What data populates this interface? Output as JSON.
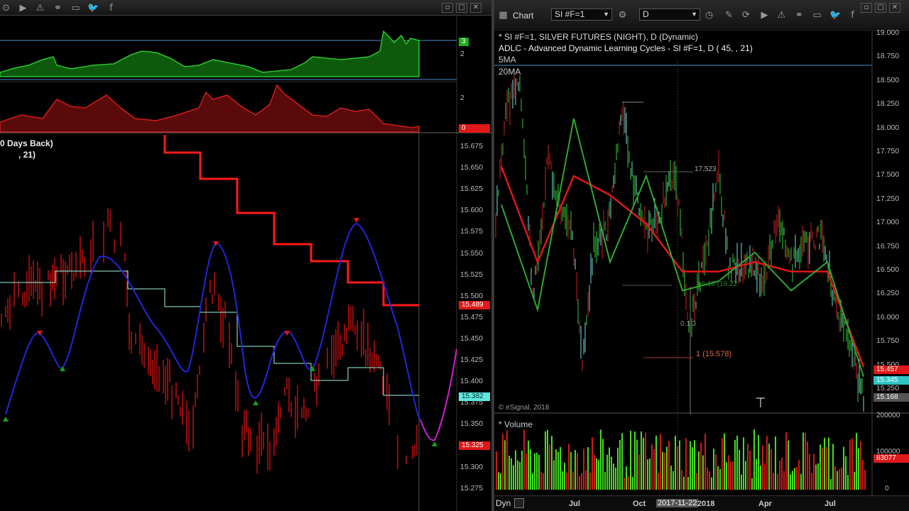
{
  "left": {
    "legend_line1": "0 Days Back)",
    "legend_line2": ", 21)",
    "osc1_tags": {
      "top": "3",
      "mid": "2"
    },
    "osc2_tags": {
      "mid": "2",
      "zero": "0"
    },
    "price_ticks": [
      "15.675",
      "15.650",
      "15.625",
      "15.600",
      "15.575",
      "15.550",
      "15.525",
      "15.500",
      "15.475",
      "15.450",
      "15.425",
      "15.400",
      "15.375",
      "15.350",
      "15.325",
      "15.300",
      "15.275"
    ],
    "price_tags": {
      "red1": "15.489",
      "cyan": "15.382",
      "red2": "15.325"
    },
    "colors": {
      "green": "#1fae1f",
      "red": "#c01010",
      "blue": "#2020d0",
      "cyan": "#9ff6e8",
      "magenta": "#d020d0"
    }
  },
  "right": {
    "window_title": "Chart",
    "symbol_field": "SI #F=1",
    "interval_field": "D",
    "header_line1": "* SI #F=1, SILVER FUTURES (NIGHT), D (Dynamic)",
    "header_line2": "ADLC - Advanced Dynamic Learning Cycles - SI #F=1, D (        45,         , 21)",
    "ma_labels": [
      "5MA",
      "20MA"
    ],
    "price_ticks": [
      "19.000",
      "18.750",
      "18.500",
      "18.250",
      "18.000",
      "17.750",
      "17.500",
      "17.250",
      "17.000",
      "16.750",
      "16.500",
      "16.250",
      "16.000",
      "15.750",
      "15.500",
      "15.250"
    ],
    "price_tags": {
      "red": "15.457",
      "cyan": "15.345",
      "gray": "15.168"
    },
    "annotations": {
      "high": "17.523",
      "mid": "16.18  (16.22",
      "low_a": "0.1 3",
      "low_b": "1 (15.578)"
    },
    "copyright": "© eSignal, 2018",
    "volume_title": "* Volume",
    "volume_ticks": [
      "200000",
      "100000",
      "0"
    ],
    "volume_tag": "83077",
    "date_labels": [
      "Jul",
      "Oct",
      "2018",
      "Apr",
      "Jul"
    ],
    "date_highlight": "2017-11-22",
    "dyn_label": "Dyn",
    "chart_data": {
      "type": "line",
      "title": "* SI #F=1, SILVER FUTURES (NIGHT), D (Dynamic)",
      "ylim": [
        15.168,
        19.0
      ],
      "x": [
        "Jul",
        "Oct",
        "2018",
        "Apr",
        "Jul"
      ],
      "series": [
        {
          "name": "5MA",
          "values": [
            17.2,
            16.1,
            18.1,
            16.6,
            17.5,
            16.3,
            16.4,
            16.7,
            16.3,
            16.6,
            15.4
          ]
        },
        {
          "name": "20MA",
          "values": [
            17.6,
            16.6,
            17.5,
            17.3,
            17.0,
            16.5,
            16.5,
            16.6,
            16.5,
            16.5,
            15.5
          ]
        }
      ],
      "grid": false,
      "legend": "top-left"
    }
  }
}
